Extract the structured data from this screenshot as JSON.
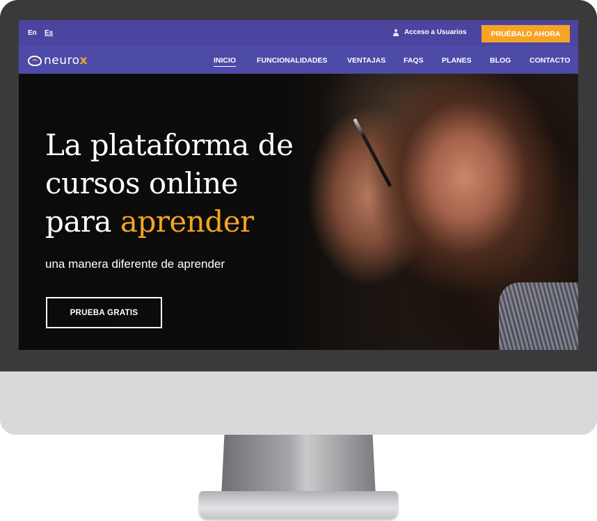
{
  "topbar": {
    "languages": [
      "En",
      "Es"
    ],
    "user_access": "Acceso a Usuarios",
    "cta": "PRUÉBALO AHORA"
  },
  "brand": {
    "name": "neuro",
    "name_accent": "x"
  },
  "nav": {
    "items": [
      "INICIO",
      "FUNCIONALIDADES",
      "VENTAJAS",
      "FAQS",
      "PLANES",
      "BLOG",
      "CONTACTO"
    ],
    "active": "INICIO"
  },
  "hero": {
    "title_lines": [
      "La plataforma de",
      "cursos online",
      "para "
    ],
    "title_accent": "aprender",
    "subtitle": "una manera diferente de aprender",
    "button": "PRUEBA GRATIS"
  },
  "colors": {
    "topbar": "#4b45a0",
    "nav": "#4d4aa8",
    "accent": "#f5a424"
  },
  "icons": {
    "user": "user-icon",
    "logo": "brain-logo-icon"
  }
}
